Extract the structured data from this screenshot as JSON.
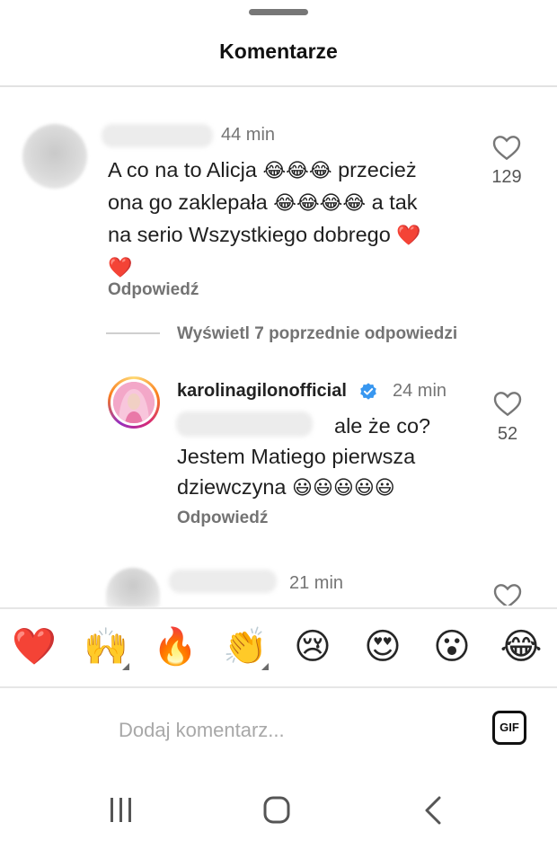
{
  "header": {
    "title": "Komentarze"
  },
  "comments": [
    {
      "time": "44 min",
      "text_line1": "A co na to Alicja",
      "text_line1_emoji": "😂😂😂",
      "text_line1_after": "przecież",
      "text_line2": "ona go zaklepała",
      "text_line2_emoji": "😂😂😂😂",
      "text_line2_after": "a tak",
      "text_line3": "na serio Wszystkiego dobrego",
      "text_line3_emoji": "❤️",
      "text_line4_emoji": "❤️",
      "likes": "129",
      "reply_label": "Odpowiedź"
    }
  ],
  "thread": {
    "view_replies_label": "Wyświetl 7 poprzednie odpowiedzi"
  },
  "reply_comment": {
    "username": "karolinagilonofficial",
    "time": "24 min",
    "text_line1": "ale że co?",
    "text_line2": "Jestem Matiego pierwsza",
    "text_line3": "dziewczyna",
    "text_line3_emoji": "😃😃😃😃😃",
    "likes": "52",
    "reply_label": "Odpowiedź"
  },
  "next_comment": {
    "time": "21 min"
  },
  "emoji_bar": [
    {
      "glyph": "❤️",
      "name": "red-heart",
      "variants": false
    },
    {
      "glyph": "🙌",
      "name": "raising-hands",
      "variants": true
    },
    {
      "glyph": "🔥",
      "name": "fire",
      "variants": false
    },
    {
      "glyph": "👏",
      "name": "clapping-hands",
      "variants": true
    },
    {
      "glyph": "😢",
      "name": "crying-face",
      "variants": false
    },
    {
      "glyph": "😍",
      "name": "heart-eyes",
      "variants": false
    },
    {
      "glyph": "😮",
      "name": "surprised-face",
      "variants": false
    },
    {
      "glyph": "😂",
      "name": "tears-of-joy",
      "variants": false
    }
  ],
  "composer": {
    "placeholder": "Dodaj komentarz...",
    "gif_label": "GIF"
  },
  "icons": {
    "like": "heart-outline-icon",
    "verified": "verified-badge-icon",
    "nav_recents": "recents-icon",
    "nav_home": "home-icon",
    "nav_back": "back-icon"
  },
  "colors": {
    "verified_blue": "#3897f0",
    "text": "#262626",
    "muted": "#737373"
  }
}
